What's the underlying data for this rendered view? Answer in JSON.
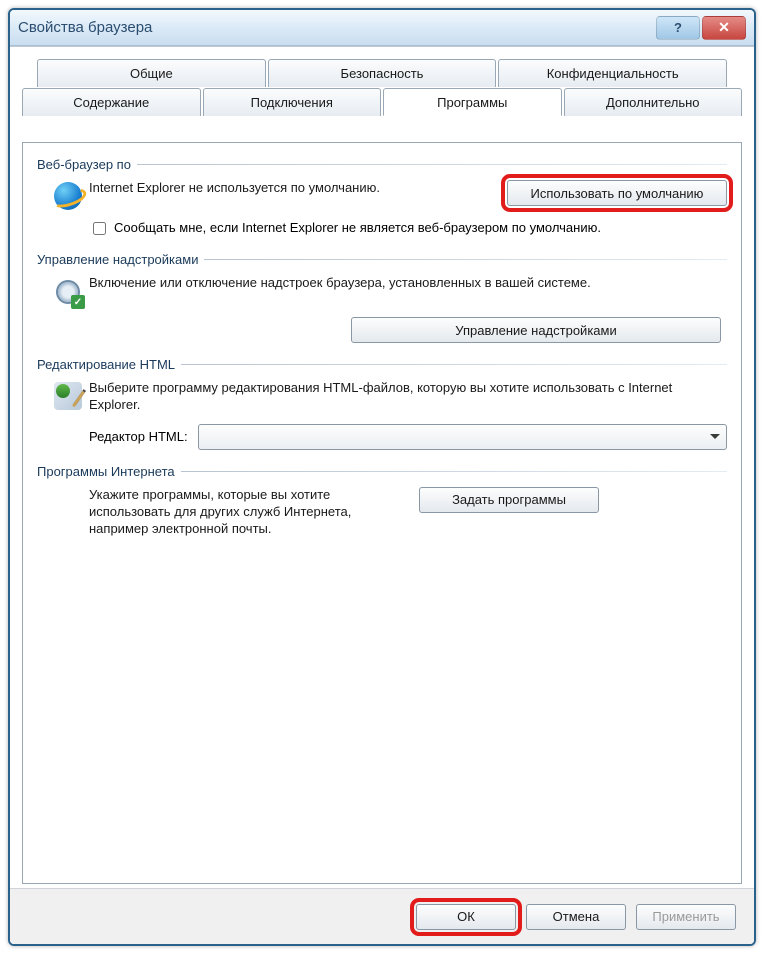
{
  "window": {
    "title": "Свойства браузера"
  },
  "tabs": {
    "general": "Общие",
    "security": "Безопасность",
    "privacy": "Конфиденциальность",
    "content": "Содержание",
    "connections": "Подключения",
    "programs": "Программы",
    "advanced": "Дополнительно"
  },
  "groups": {
    "default_browser": {
      "title": "Веб-браузер по",
      "status_text": "Internet Explorer не используется по умолчанию.",
      "set_default_btn": "Использовать по умолчанию",
      "notify_checkbox_label": "Сообщать мне, если Internet Explorer не является веб-браузером по умолчанию.",
      "notify_checked": false
    },
    "addons": {
      "title": "Управление надстройками",
      "description": "Включение или отключение надстроек браузера, установленных в вашей системе.",
      "manage_btn": "Управление надстройками"
    },
    "html_editing": {
      "title": "Редактирование HTML",
      "description": "Выберите программу редактирования HTML-файлов, которую вы хотите использовать с Internet Explorer.",
      "editor_label": "Редактор HTML:",
      "editor_value": ""
    },
    "internet_programs": {
      "title": "Программы Интернета",
      "description": "Укажите программы, которые вы хотите использовать для других служб Интернета, например электронной почты.",
      "set_programs_btn": "Задать программы"
    }
  },
  "buttons": {
    "ok": "ОК",
    "cancel": "Отмена",
    "apply": "Применить"
  }
}
